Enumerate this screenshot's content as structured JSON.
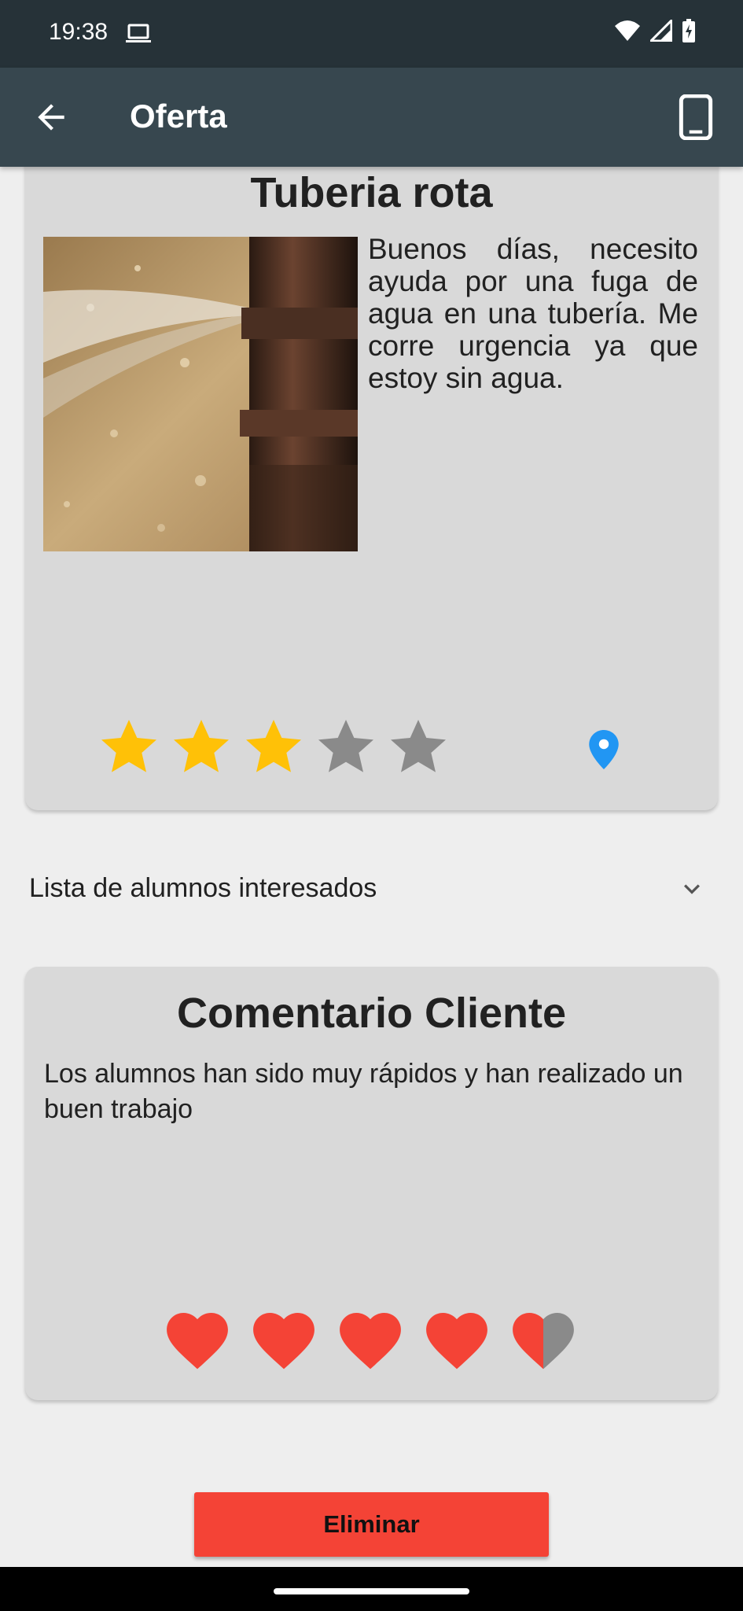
{
  "status_bar": {
    "time": "19:38",
    "icons": [
      "laptop-icon",
      "wifi-icon",
      "signal-icon",
      "battery-charging-icon"
    ]
  },
  "app_bar": {
    "title": "Oferta",
    "back_icon": "arrow-back-icon",
    "action_icon": "smartphone-icon"
  },
  "offer": {
    "title": "Tuberia rota",
    "image": "burst-pipe-photo",
    "description": "Buenos días, necesito ayuda por una fuga de agua en una tubería. Me corre urgencia ya que estoy sin agua.",
    "rating": {
      "value": 3,
      "max": 5,
      "filled_color": "#FFC107",
      "empty_color": "#8A8A8A"
    },
    "location_icon": "location-pin-icon",
    "location_color": "#2196F3"
  },
  "interested_list": {
    "label": "Lista de alumnos interesados",
    "chevron_icon": "chevron-down-icon"
  },
  "comment": {
    "title": "Comentario Cliente",
    "text": "Los alumnos han sido muy rápidos y han realizado un buen trabajo",
    "rating": {
      "value": 4.5,
      "max": 5,
      "filled_color": "#F44336",
      "empty_color": "#8A8A8A"
    }
  },
  "actions": {
    "delete_label": "Eliminar",
    "delete_color": "#F44336"
  }
}
